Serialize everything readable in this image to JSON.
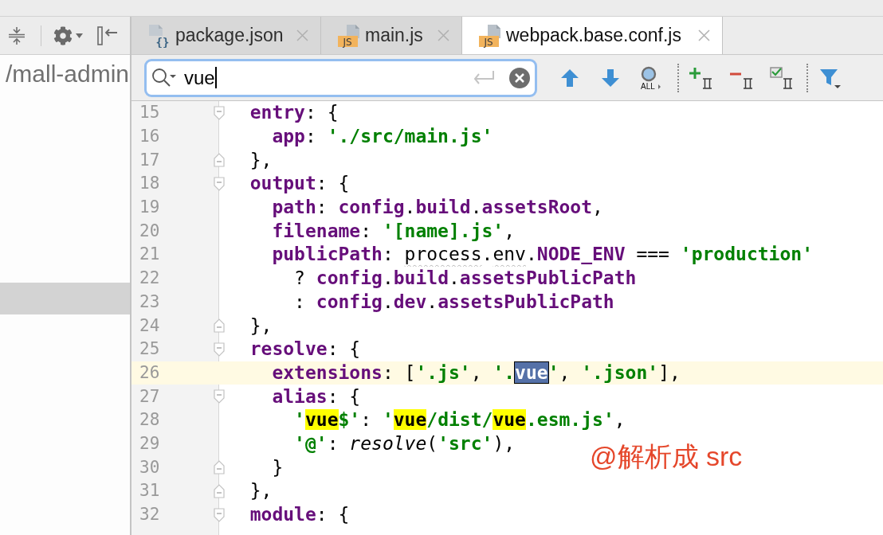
{
  "project_panel": {
    "path": "/mall-admin",
    "row_selected": true
  },
  "tabs": [
    {
      "label": "package.json",
      "kind": "json",
      "icon_text": "{}",
      "selected": false
    },
    {
      "label": "main.js",
      "kind": "js",
      "icon_text": "JS",
      "selected": false
    },
    {
      "label": "webpack.base.conf.js",
      "kind": "js",
      "icon_text": "JS",
      "selected": true
    }
  ],
  "search": {
    "value": "vue",
    "find_all_label": "ALL"
  },
  "editor": {
    "lines": [
      {
        "number": "15",
        "kind": "fold_start",
        "current": false,
        "tokens": [
          {
            "kind": "key",
            "text": "  entry"
          },
          {
            "kind": "plain",
            "text": ": {"
          }
        ]
      },
      {
        "number": "16",
        "kind": "plain",
        "current": false,
        "tokens": [
          {
            "kind": "key",
            "text": "    app"
          },
          {
            "kind": "plain",
            "text": ": "
          },
          {
            "kind": "string",
            "text": "'./src/main.js'"
          }
        ]
      },
      {
        "number": "17",
        "kind": "fold_end",
        "current": false,
        "tokens": [
          {
            "kind": "plain",
            "text": "  },"
          }
        ]
      },
      {
        "number": "18",
        "kind": "fold_start",
        "current": false,
        "tokens": [
          {
            "kind": "key",
            "text": "  output"
          },
          {
            "kind": "plain",
            "text": ": {"
          }
        ]
      },
      {
        "number": "19",
        "kind": "plain",
        "current": false,
        "tokens": [
          {
            "kind": "key",
            "text": "    path"
          },
          {
            "kind": "plain",
            "text": ": "
          },
          {
            "kind": "key",
            "text": "config"
          },
          {
            "kind": "plain",
            "text": "."
          },
          {
            "kind": "key",
            "text": "build"
          },
          {
            "kind": "plain",
            "text": "."
          },
          {
            "kind": "key",
            "text": "assetsRoot"
          },
          {
            "kind": "plain",
            "text": ","
          }
        ]
      },
      {
        "number": "20",
        "kind": "plain",
        "current": false,
        "tokens": [
          {
            "kind": "key",
            "text": "    filename"
          },
          {
            "kind": "plain",
            "text": ": "
          },
          {
            "kind": "string",
            "text": "'[name].js'"
          },
          {
            "kind": "plain",
            "text": ","
          }
        ]
      },
      {
        "number": "21",
        "kind": "plain",
        "current": false,
        "tokens": [
          {
            "kind": "key",
            "text": "    publicPath"
          },
          {
            "kind": "plain",
            "text": ": "
          },
          {
            "kind": "warn",
            "text": "process"
          },
          {
            "kind": "plain",
            "text": "."
          },
          {
            "kind": "warn",
            "text": "env"
          },
          {
            "kind": "plain",
            "text": "."
          },
          {
            "kind": "key",
            "text": "NODE_ENV"
          },
          {
            "kind": "plain",
            "text": " === "
          },
          {
            "kind": "string",
            "text": "'production'"
          }
        ]
      },
      {
        "number": "22",
        "kind": "plain",
        "current": false,
        "tokens": [
          {
            "kind": "plain",
            "text": "      ? "
          },
          {
            "kind": "key",
            "text": "config"
          },
          {
            "kind": "plain",
            "text": "."
          },
          {
            "kind": "key",
            "text": "build"
          },
          {
            "kind": "plain",
            "text": "."
          },
          {
            "kind": "key",
            "text": "assetsPublicPath"
          }
        ]
      },
      {
        "number": "23",
        "kind": "plain",
        "current": false,
        "tokens": [
          {
            "kind": "plain",
            "text": "      : "
          },
          {
            "kind": "key",
            "text": "config"
          },
          {
            "kind": "plain",
            "text": "."
          },
          {
            "kind": "key",
            "text": "dev"
          },
          {
            "kind": "plain",
            "text": "."
          },
          {
            "kind": "key",
            "text": "assetsPublicPath"
          }
        ]
      },
      {
        "number": "24",
        "kind": "fold_end",
        "current": false,
        "tokens": [
          {
            "kind": "plain",
            "text": "  },"
          }
        ]
      },
      {
        "number": "25",
        "kind": "fold_start",
        "current": false,
        "tokens": [
          {
            "kind": "key",
            "text": "  resolve"
          },
          {
            "kind": "plain",
            "text": ": {"
          }
        ]
      },
      {
        "number": "26",
        "kind": "plain",
        "current": true,
        "tokens": [
          {
            "kind": "key",
            "text": "    extensions"
          },
          {
            "kind": "plain",
            "text": ": ["
          },
          {
            "kind": "string",
            "text": "'.js'"
          },
          {
            "kind": "plain",
            "text": ", "
          },
          {
            "kind": "string",
            "text": "'."
          },
          {
            "kind": "current_match",
            "text": "vue"
          },
          {
            "kind": "string",
            "text": "'"
          },
          {
            "kind": "plain",
            "text": ", "
          },
          {
            "kind": "string",
            "text": "'.json'"
          },
          {
            "kind": "plain",
            "text": "],"
          }
        ]
      },
      {
        "number": "27",
        "kind": "fold_start",
        "current": false,
        "tokens": [
          {
            "kind": "key",
            "text": "    alias"
          },
          {
            "kind": "plain",
            "text": ": {"
          }
        ]
      },
      {
        "number": "28",
        "kind": "plain",
        "current": false,
        "tokens": [
          {
            "kind": "string",
            "text": "      '"
          },
          {
            "kind": "match",
            "text": "vue"
          },
          {
            "kind": "string",
            "text": "$'"
          },
          {
            "kind": "plain",
            "text": ": "
          },
          {
            "kind": "string",
            "text": "'"
          },
          {
            "kind": "match",
            "text": "vue"
          },
          {
            "kind": "string",
            "text": "/dist/"
          },
          {
            "kind": "match",
            "text": "vue"
          },
          {
            "kind": "string",
            "text": ".esm.js'"
          },
          {
            "kind": "plain",
            "text": ","
          }
        ]
      },
      {
        "number": "29",
        "kind": "plain",
        "current": false,
        "tokens": [
          {
            "kind": "string",
            "text": "      '@'"
          },
          {
            "kind": "plain",
            "text": ": "
          },
          {
            "kind": "call",
            "text": "resolve"
          },
          {
            "kind": "plain",
            "text": "("
          },
          {
            "kind": "string",
            "text": "'src'"
          },
          {
            "kind": "plain",
            "text": "),"
          }
        ]
      },
      {
        "number": "30",
        "kind": "fold_end",
        "current": false,
        "tokens": [
          {
            "kind": "plain",
            "text": "    }"
          }
        ]
      },
      {
        "number": "31",
        "kind": "fold_end",
        "current": false,
        "tokens": [
          {
            "kind": "plain",
            "text": "  },"
          }
        ]
      },
      {
        "number": "32",
        "kind": "fold_start",
        "current": false,
        "tokens": [
          {
            "kind": "key",
            "text": "  module"
          },
          {
            "kind": "plain",
            "text": ": {"
          }
        ]
      }
    ]
  },
  "annotation": "@解析成 src"
}
